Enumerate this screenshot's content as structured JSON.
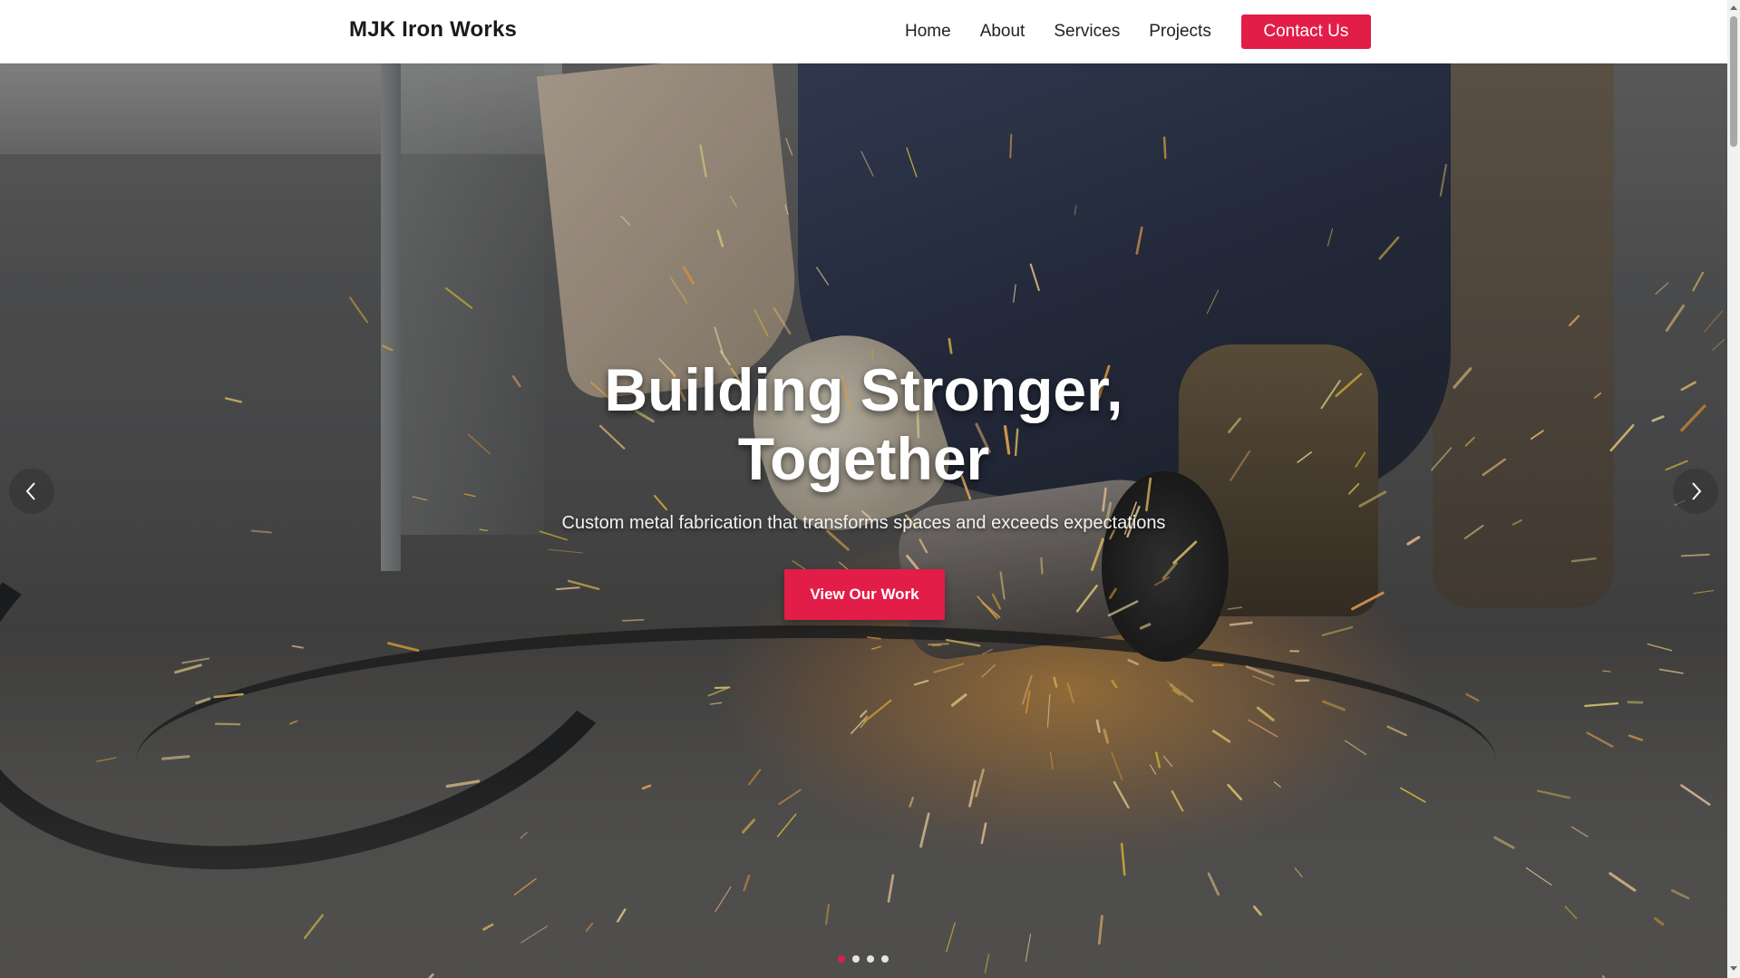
{
  "navbar": {
    "brand": "MJK Iron Works",
    "links": [
      "Home",
      "About",
      "Services",
      "Projects"
    ],
    "cta_label": "Contact Us"
  },
  "hero": {
    "title_line1": "Building Stronger,",
    "title_line2": "Together",
    "subtitle": "Custom metal fabrication that transforms spaces and exceeds expectations",
    "button_label": "View Our Work",
    "background_image": "welder-grinding-sparks",
    "slides_total": 4,
    "active_slide": 1
  },
  "icons": {
    "prev": "chevron-left-icon",
    "next": "chevron-right-icon"
  },
  "colors": {
    "accent": "#e11d48",
    "nav_bg": "#ffffff",
    "text_dark": "#1a1a1a"
  }
}
